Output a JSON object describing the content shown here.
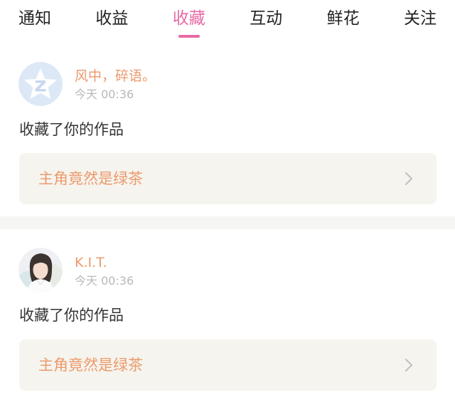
{
  "tabs": [
    {
      "label": "通知",
      "active": false
    },
    {
      "label": "收益",
      "active": false
    },
    {
      "label": "收藏",
      "active": true
    },
    {
      "label": "互动",
      "active": false
    },
    {
      "label": "鲜花",
      "active": false
    },
    {
      "label": "关注",
      "active": false
    }
  ],
  "accent_color": "#e86aa6",
  "notifications": [
    {
      "user_name": "风中，碎语。",
      "time": "今天 00:36",
      "action": "收藏了你的作品",
      "work_title": "主角竟然是绿茶",
      "avatar": "default-qq-avatar-icon"
    },
    {
      "user_name": "K.I.T.",
      "time": "今天 00:36",
      "action": "收藏了你的作品",
      "work_title": "主角竟然是绿茶",
      "avatar": "user-photo-avatar"
    }
  ]
}
